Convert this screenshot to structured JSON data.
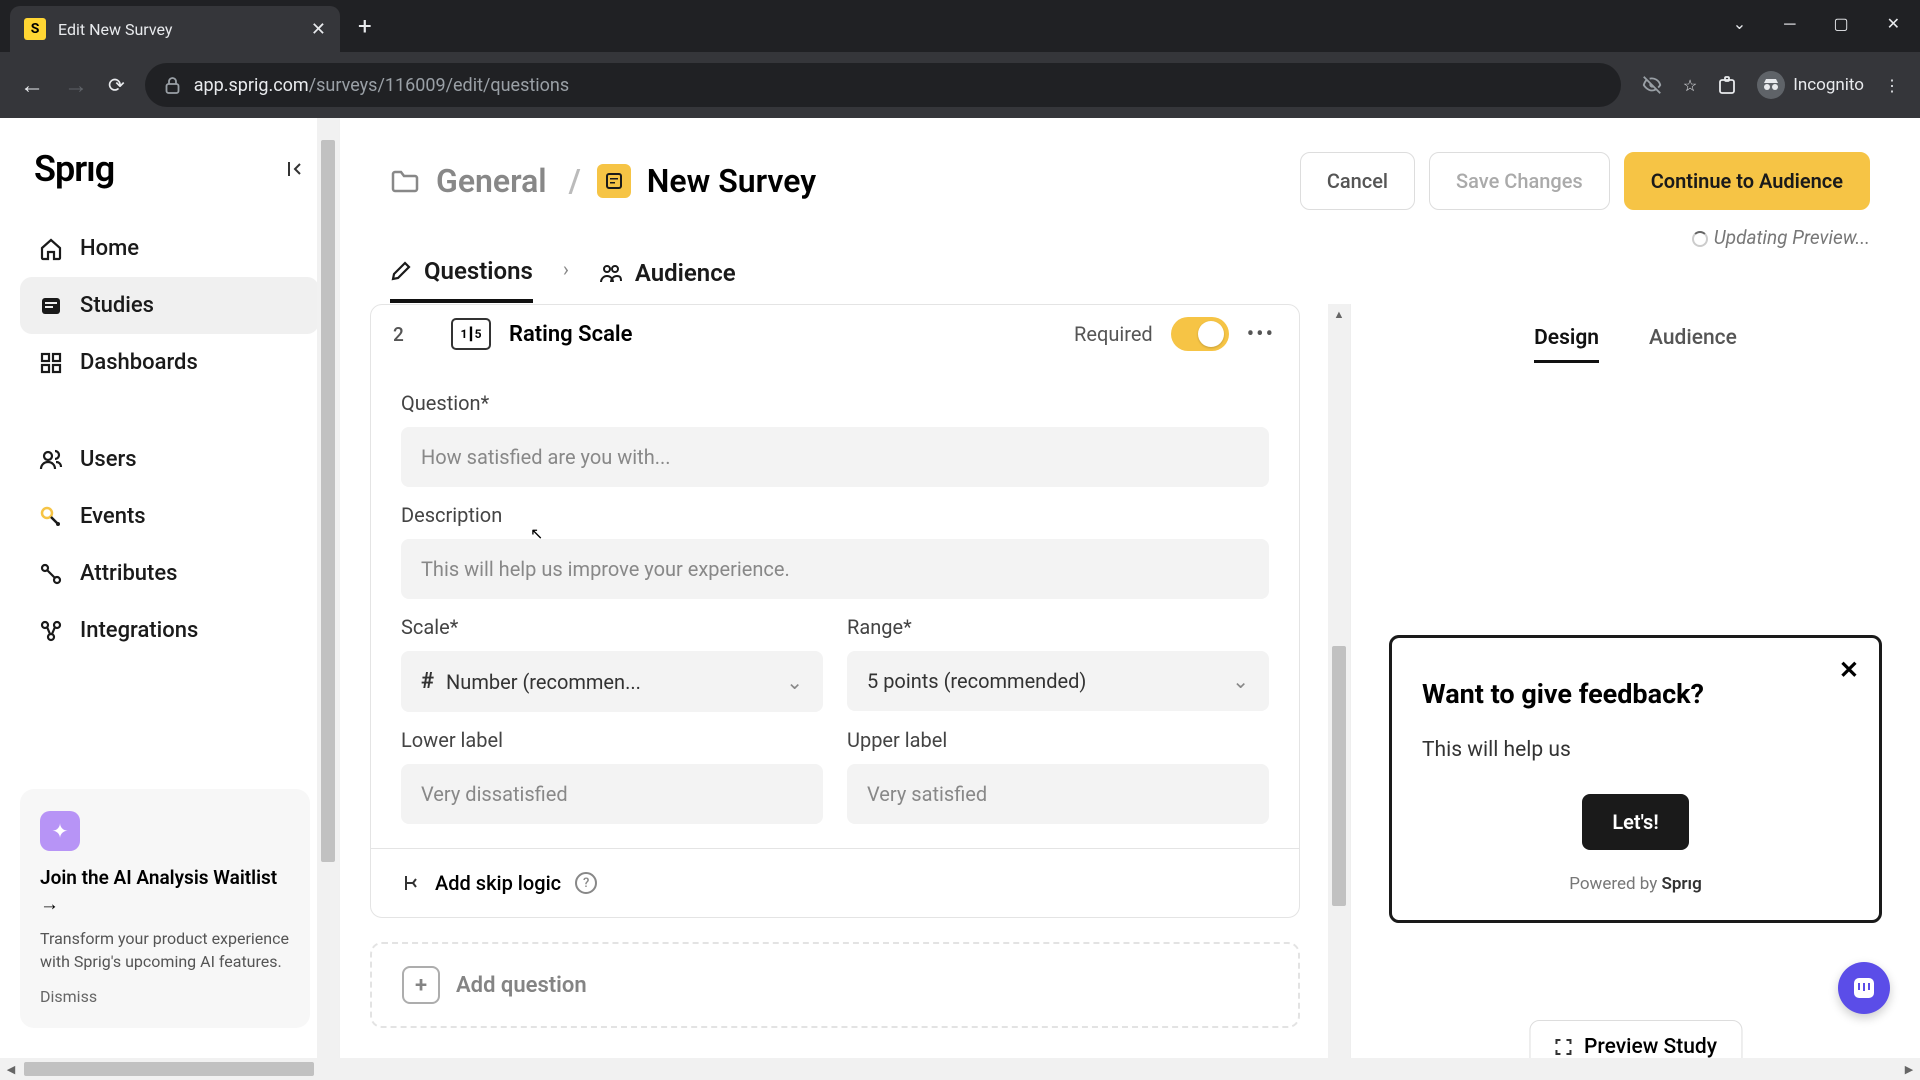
{
  "browser": {
    "tab_title": "Edit New Survey",
    "url_domain": "app.sprig.com",
    "url_path": "/surveys/116009/edit/questions",
    "incognito": "Incognito"
  },
  "sidebar": {
    "logo": "Sprıg",
    "items": [
      {
        "label": "Home"
      },
      {
        "label": "Studies"
      },
      {
        "label": "Dashboards"
      },
      {
        "label": "Users"
      },
      {
        "label": "Events"
      },
      {
        "label": "Attributes"
      },
      {
        "label": "Integrations"
      }
    ],
    "promo": {
      "title": "Join the AI Analysis Waitlist →",
      "body": "Transform your product experience with Sprig's upcoming AI features.",
      "dismiss": "Dismiss"
    }
  },
  "header": {
    "folder": "General",
    "title": "New Survey",
    "cancel": "Cancel",
    "save": "Save Changes",
    "continue": "Continue to Audience",
    "status": "Updating Preview..."
  },
  "steps": {
    "questions": "Questions",
    "audience": "Audience"
  },
  "question": {
    "number": "2",
    "type": "Rating Scale",
    "required": "Required",
    "q_label": "Question*",
    "q_placeholder": "How satisfied are you with...",
    "desc_label": "Description",
    "desc_placeholder": "This will help us improve your experience.",
    "scale_label": "Scale*",
    "scale_value": "Number (recommen...",
    "range_label": "Range*",
    "range_value": "5 points (recommended)",
    "lower_label": "Lower label",
    "lower_placeholder": "Very dissatisfied",
    "upper_label": "Upper label",
    "upper_placeholder": "Very satisfied",
    "skip_logic": "Add skip logic",
    "add_question": "Add question"
  },
  "preview": {
    "tab_design": "Design",
    "tab_audience": "Audience",
    "popup_title": "Want to give feedback?",
    "popup_body": "This will help us",
    "popup_cta": "Let's!",
    "powered_prefix": "Powered by ",
    "powered_brand": "Sprıg",
    "preview_study": "Preview Study"
  }
}
